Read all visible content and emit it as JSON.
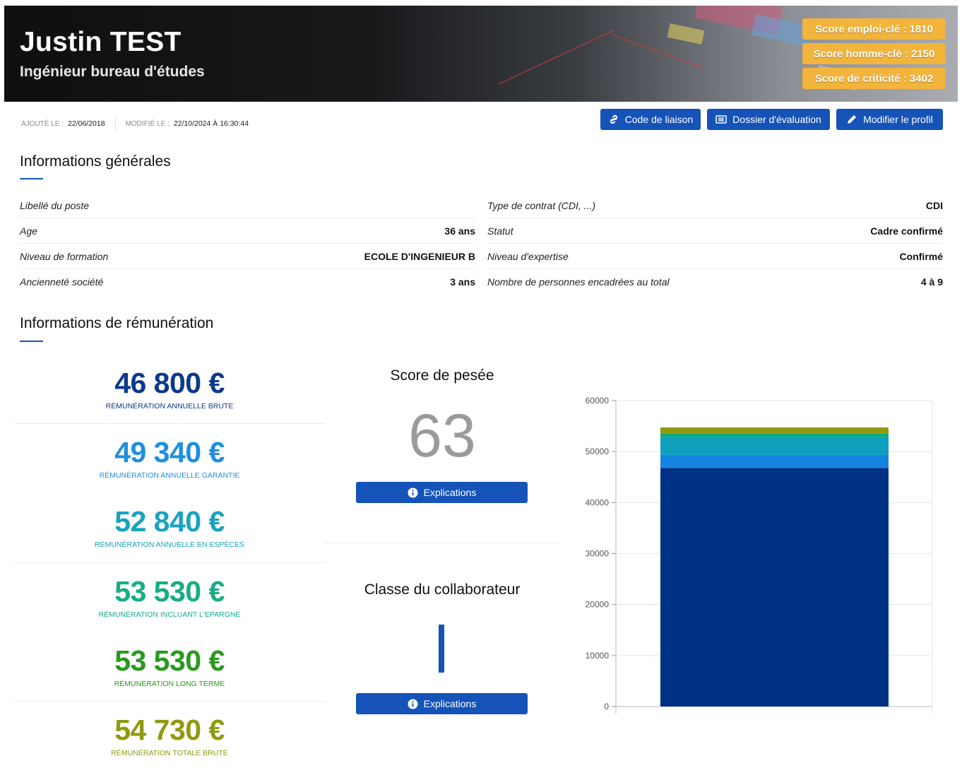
{
  "header": {
    "name": "Justin TEST",
    "job_title": "Ingénieur bureau d'études",
    "badges": [
      "Score emploi-clé : 1810",
      "Score homme-clé : 2150",
      "Score de criticité : 3402"
    ]
  },
  "meta": {
    "added_label": "AJOUTÉ LE :",
    "added_value": "22/06/2018",
    "modified_label": "MODIFIÉ LE :",
    "modified_value": "22/10/2024 À 16:30:44"
  },
  "actions": {
    "link_code": "Code de liaison",
    "eval_file": "Dossier d'évaluation",
    "edit_profile": "Modifier le profil"
  },
  "general": {
    "title": "Informations générales",
    "left": [
      {
        "label": "Libellé du poste",
        "value": ""
      },
      {
        "label": "Age",
        "value": "36 ans"
      },
      {
        "label": "Niveau de formation",
        "value": "ECOLE D'INGENIEUR B"
      },
      {
        "label": "Ancienneté société",
        "value": "3 ans"
      }
    ],
    "right": [
      {
        "label": "Type de contrat (CDI, ...)",
        "value": "CDI"
      },
      {
        "label": "Statut",
        "value": "Cadre confirmé"
      },
      {
        "label": "Niveau d'expertise",
        "value": "Confirmé"
      },
      {
        "label": "Nombre de personnes encadrées au total",
        "value": "4 à 9"
      }
    ]
  },
  "remuneration": {
    "title": "Informations de rémunération",
    "items": [
      {
        "amount": "46 800 €",
        "caption": "RÉMUNÉRATION ANNUELLE BRUTE",
        "color": "#0b3a8c"
      },
      {
        "amount": "49 340 €",
        "caption": "RÉMUNÉRATION ANNUELLE GARANTIE",
        "color": "#1f8fe0"
      },
      {
        "amount": "52 840 €",
        "caption": "RÉMUNÉRATION ANNUELLE EN ESPÈCES",
        "color": "#1aa3bf"
      },
      {
        "amount": "53 530 €",
        "caption": "RÉMUNÉRATION INCLUANT L'EPARGNE",
        "color": "#18ad86"
      },
      {
        "amount": "53 530 €",
        "caption": "RÉMUNÉRATION LONG TERME",
        "color": "#2a9a1e"
      },
      {
        "amount": "54 730 €",
        "caption": "RÉMUNÉRATION TOTALE BRUTE",
        "color": "#8f9a10"
      }
    ]
  },
  "weighing": {
    "title": "Score de pesée",
    "value": "63",
    "explain_label": "Explications"
  },
  "class": {
    "title": "Classe du collaborateur",
    "value": "I",
    "explain_label": "Explications"
  },
  "icons": {
    "link": "link-icon",
    "file": "file-list-icon",
    "edit": "pencil-icon",
    "info": "info-circle-icon"
  },
  "chart_data": {
    "type": "bar",
    "stacked": true,
    "categories": [
      ""
    ],
    "ylim": [
      0,
      60000
    ],
    "yticks": [
      0,
      10000,
      20000,
      30000,
      40000,
      50000,
      60000
    ],
    "grid": true,
    "series": [
      {
        "values": [
          46800
        ],
        "color": "#013184"
      },
      {
        "values": [
          2540
        ],
        "color": "#1584e0"
      },
      {
        "values": [
          3500
        ],
        "color": "#0ea0be"
      },
      {
        "values": [
          690
        ],
        "color": "#0aa882"
      },
      {
        "values": [
          0
        ],
        "color": "#2a9a1e"
      },
      {
        "values": [
          1200
        ],
        "color": "#8f9a10"
      }
    ]
  }
}
